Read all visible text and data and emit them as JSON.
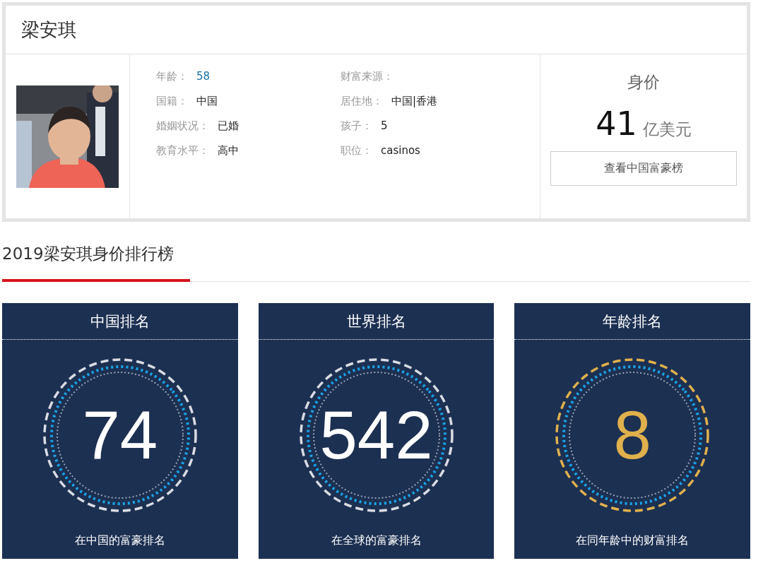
{
  "profile": {
    "name": "梁安琪",
    "left_fields": [
      {
        "label": "年龄：",
        "value": "58",
        "kind": "link"
      },
      {
        "label": "国籍：",
        "value": "中国",
        "kind": "text"
      },
      {
        "label": "婚姻状况：",
        "value": "已婚",
        "kind": "text"
      },
      {
        "label": "教育水平：",
        "value": "高中",
        "kind": "text"
      }
    ],
    "right_fields": [
      {
        "label": "财富来源："
      },
      {
        "label": "居住地：",
        "value": "中国|香港"
      },
      {
        "label": "孩子：",
        "value": "5"
      },
      {
        "label": "职位：",
        "value": "casinos"
      }
    ],
    "net_worth": {
      "label": "身价",
      "amount": "41",
      "unit": "亿美元",
      "button": "查看中国富豪榜"
    }
  },
  "ranking": {
    "title": "2019梁安琪身价排行榜",
    "cards": [
      {
        "title": "中国排名",
        "rank": "74",
        "caption": "在中国的富豪排名",
        "color": "#ffffff"
      },
      {
        "title": "世界排名",
        "rank": "542",
        "caption": "在全球的富豪排名",
        "color": "#ffffff"
      },
      {
        "title": "年龄排名",
        "rank": "8",
        "caption": "在同年龄中的财富排名",
        "color": "#e0b04c"
      }
    ]
  }
}
